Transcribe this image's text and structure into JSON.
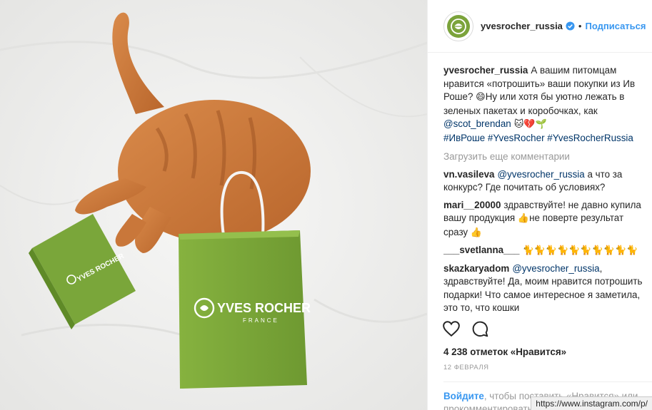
{
  "header": {
    "username": "yvesrocher_russia",
    "separator": "•",
    "follow_label": "Подписаться"
  },
  "caption": {
    "author": "yvesrocher_russia",
    "text_1": "А вашим питомцам нравится «потрошить» ваши покупки из Ив Роше? ",
    "emoji_1": "😄",
    "text_2": "Ну или хотя бы уютно лежать в зеленых пакетах и коробочках, как ",
    "mention": "@scot_brendan",
    "emoji_2": " 🐱💔🌱",
    "hashtags": "#ИвРоше #YvesRocher #YvesRocherRussia"
  },
  "load_more_label": "Загрузить еще комментарии",
  "comments": [
    {
      "author": "vn.vasileva",
      "mention": "@yvesrocher_russia",
      "text": " а что за конкурс? Где почитать об условиях?"
    },
    {
      "author": "mari__20000",
      "text": "здравствуйте! не давно купила вашу продукция ",
      "emoji": "👍",
      "text_2": "не поверте результат сразу ",
      "emoji_2": "👍"
    },
    {
      "author": "___svetlanna___",
      "emoji": "🐈🐈🐈🐈🐈🐈🐈🐈🐈🐈"
    },
    {
      "author": "skazkaryadom",
      "mention": "@yvesrocher_russia",
      "text": ", здравствуйте! Да, моим нравится потрошить подарки! Что самое интересное я заметила, это то, что кошки"
    }
  ],
  "likes_text": "4 238 отметок «Нравится»",
  "date_text": "12 ФЕВРАЛЯ",
  "login_hint": {
    "login_link": "Войдите",
    "text": ", чтобы поставить «Нравится» или прокомментировать."
  },
  "status_url": "https://www.instagram.com/p/",
  "photo": {
    "box_brand": "YVES ROCHER",
    "bag_brand": "YVES ROCHER",
    "bag_sub": "FRANCE"
  },
  "icons": {
    "verified": "verified-badge-icon",
    "like": "heart-icon",
    "comment": "comment-bubble-icon",
    "logo": "yves-rocher-leaf-logo"
  },
  "colors": {
    "brand_green": "#7ba33b",
    "link_blue": "#3897f0",
    "mention_blue": "#003569",
    "muted": "#999999"
  }
}
